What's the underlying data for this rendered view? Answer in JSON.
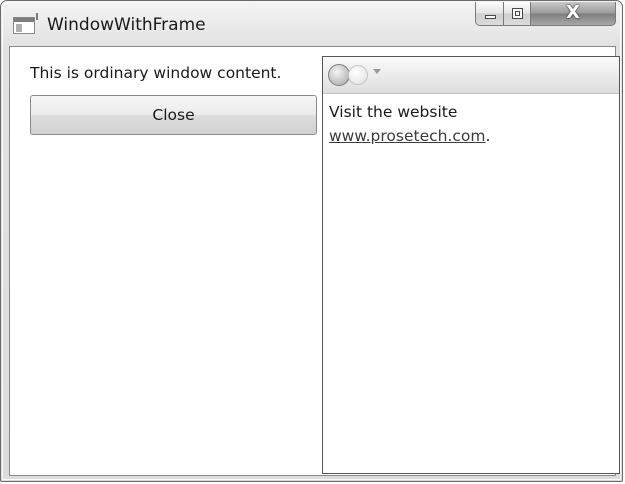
{
  "window": {
    "title": "WindowWithFrame",
    "caption": {
      "minimize_icon": "minimize-icon",
      "maximize_icon": "maximize-icon",
      "close_icon": "close-icon",
      "close_glyph": "X"
    }
  },
  "left_panel": {
    "text": "This is ordinary window content.",
    "close_label": "Close"
  },
  "frame": {
    "back_icon": "back-arrow-icon",
    "forward_icon": "forward-arrow-icon",
    "history_icon": "chevron-down-icon",
    "text": "Visit the website",
    "link_text": "www.prosetech.com",
    "after_link": "."
  }
}
